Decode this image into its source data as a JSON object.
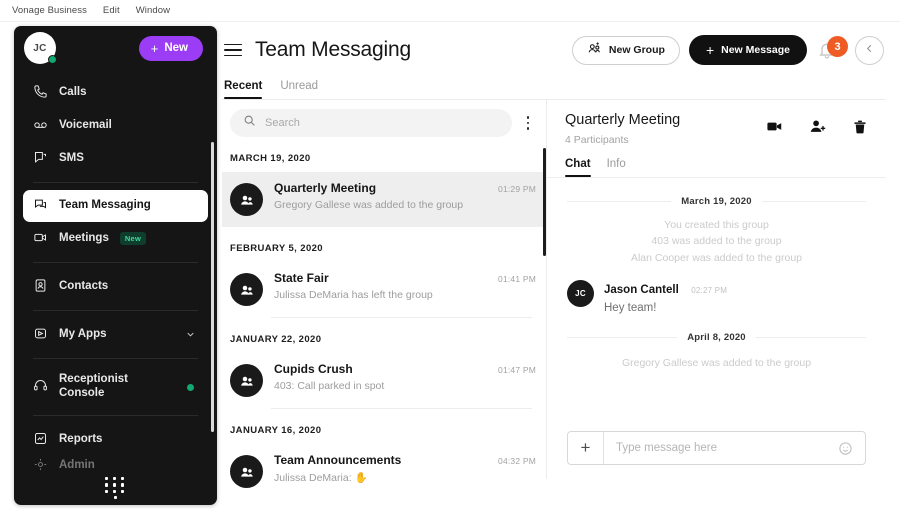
{
  "menubar": {
    "items": [
      "Vonage Business",
      "Edit",
      "Window"
    ]
  },
  "sidebar": {
    "avatar_initials": "JC",
    "new_button": {
      "label": "New",
      "icon": "plus-icon"
    },
    "items": [
      {
        "label": "Calls",
        "icon": "phone-icon"
      },
      {
        "label": "Voicemail",
        "icon": "voicemail-icon"
      },
      {
        "label": "SMS",
        "icon": "sms-icon"
      },
      {
        "label": "Team Messaging",
        "icon": "chat-bubble-icon"
      },
      {
        "label": "Meetings",
        "icon": "video-camera-icon",
        "badge": "New"
      },
      {
        "label": "Contacts",
        "icon": "contact-card-icon"
      },
      {
        "label": "My Apps",
        "icon": "apps-icon",
        "chevron": "chevron-down-icon"
      },
      {
        "label": "Receptionist Console",
        "icon": "headset-icon",
        "status": "online"
      },
      {
        "label": "Reports",
        "icon": "reports-icon"
      },
      {
        "label": "Admin",
        "icon": "admin-icon"
      }
    ],
    "dialpad_icon": "dialpad-icon"
  },
  "header": {
    "menu_icon": "hamburger-icon",
    "title": "Team Messaging",
    "new_group_label": "New Group",
    "new_message_label": "New Message",
    "notification_count": "3",
    "collapse_icon": "chevron-left-icon",
    "tabs": [
      {
        "label": "Recent",
        "active": true
      },
      {
        "label": "Unread",
        "active": false
      }
    ]
  },
  "conversation_list": {
    "search": {
      "placeholder": "Search",
      "value": "",
      "icon": "search-icon"
    },
    "more_icon": "kebab-menu-icon",
    "groups": [
      {
        "date": "MARCH 19, 2020",
        "items": [
          {
            "title": "Quarterly Meeting",
            "preview": "Gregory Gallese was added to the group",
            "time": "01:29 PM",
            "selected": true
          }
        ]
      },
      {
        "date": "FEBRUARY 5, 2020",
        "items": [
          {
            "title": "State Fair",
            "preview": "Julissa DeMaria has left the group",
            "time": "01:41 PM",
            "selected": false
          }
        ]
      },
      {
        "date": "JANUARY 22, 2020",
        "items": [
          {
            "title": "Cupids Crush",
            "preview": "403: Call parked in spot",
            "time": "01:47 PM",
            "selected": false
          }
        ]
      },
      {
        "date": "JANUARY 16, 2020",
        "items": [
          {
            "title": "Team Announcements",
            "preview": "Julissa DeMaria: ✋",
            "time": "04:32 PM",
            "selected": false
          }
        ]
      }
    ]
  },
  "chat_panel": {
    "title": "Quarterly Meeting",
    "participants": "4 Participants",
    "icons": [
      "video-camera-icon",
      "add-person-icon",
      "trash-icon"
    ],
    "tabs": [
      {
        "label": "Chat",
        "active": true
      },
      {
        "label": "Info",
        "active": false
      }
    ],
    "timeline": [
      {
        "kind": "date",
        "text": "March 19, 2020"
      },
      {
        "kind": "system",
        "text": "You created this group"
      },
      {
        "kind": "system",
        "text": "403 was added to the group"
      },
      {
        "kind": "system",
        "text": "Alan Cooper was added to the group"
      },
      {
        "kind": "message",
        "initials": "JC",
        "author": "Jason Cantell",
        "time": "02:27 PM",
        "text": "Hey team!"
      },
      {
        "kind": "date",
        "text": "April 8, 2020"
      },
      {
        "kind": "system",
        "text": "Gregory Gallese was added to the group"
      }
    ],
    "composer": {
      "placeholder": "Type message here",
      "value": "",
      "add_icon": "plus-icon",
      "emoji_icon": "emoji-icon"
    }
  },
  "colors": {
    "accent_purple": "#9b3df5",
    "badge_orange": "#ef5b25",
    "presence_green": "#13a871",
    "sidebar_bg": "#151515"
  }
}
